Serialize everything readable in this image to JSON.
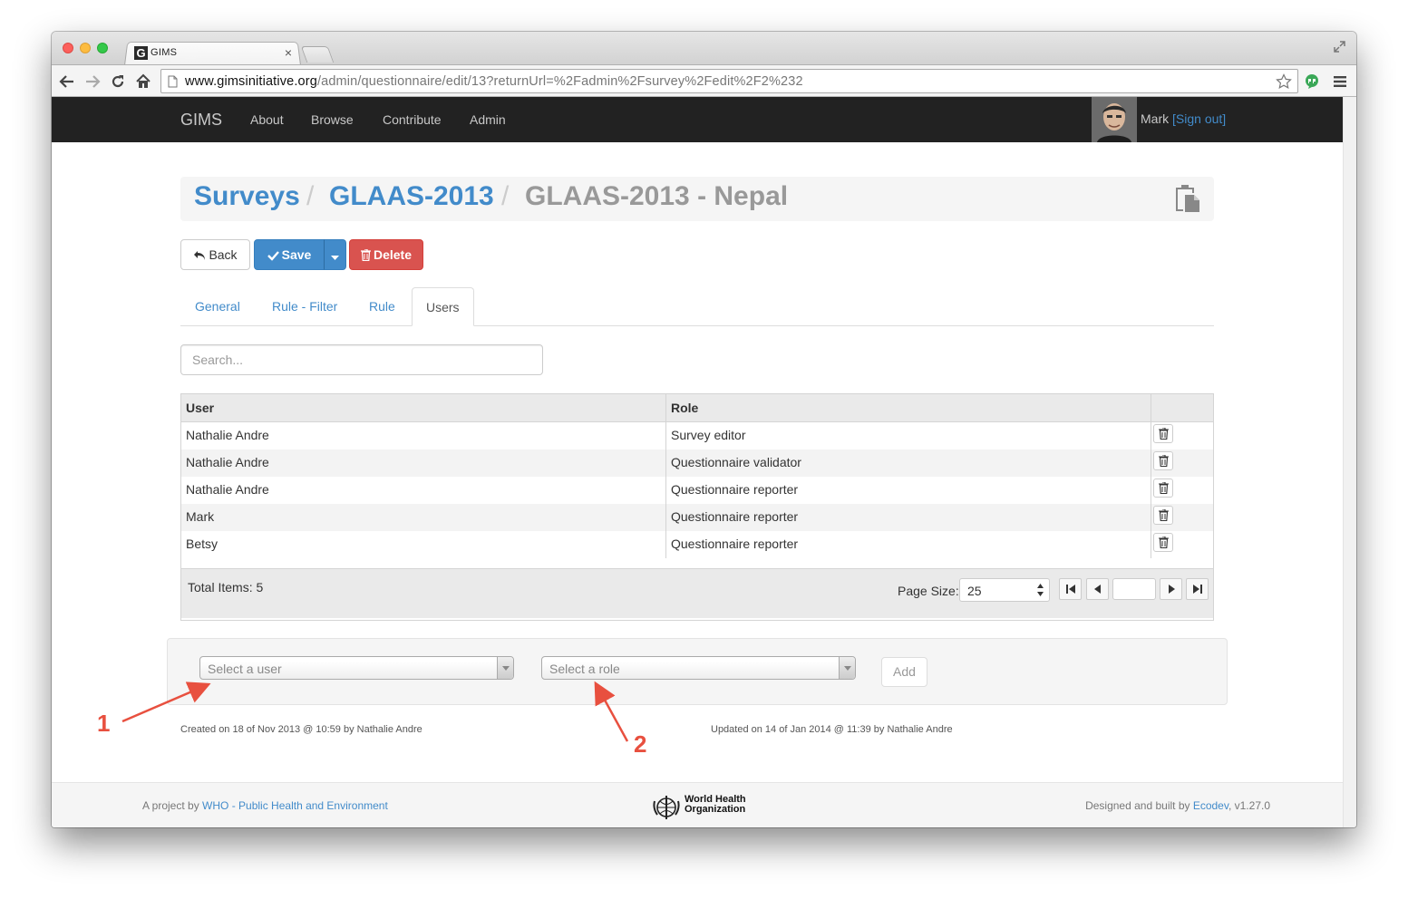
{
  "browser": {
    "tab_title": "GIMS",
    "tab_close": "×",
    "favicon_letter": "G",
    "url_host": "www.gimsinitiative.org",
    "url_path": "/admin/questionnaire/edit/13?returnUrl=%2Fadmin%2Fsurvey%2Fedit%2F2%232"
  },
  "navbar": {
    "brand": "GIMS",
    "links": [
      "About",
      "Browse",
      "Contribute",
      "Admin"
    ],
    "user_name": "Mark",
    "sign_out": "[Sign out]"
  },
  "breadcrumb": {
    "items": [
      "Surveys",
      "GLAAS-2013",
      "GLAAS-2013 - Nepal"
    ],
    "separator": "/"
  },
  "actions": {
    "back_label": "Back",
    "save_label": "Save",
    "delete_label": "Delete"
  },
  "tabs": [
    "General",
    "Rule - Filter",
    "Rule",
    "Users"
  ],
  "active_tab": "Users",
  "search": {
    "placeholder": "Search..."
  },
  "grid": {
    "columns": [
      "User",
      "Role"
    ],
    "rows": [
      {
        "user": "Nathalie Andre",
        "role": "Survey editor"
      },
      {
        "user": "Nathalie Andre",
        "role": "Questionnaire validator"
      },
      {
        "user": "Nathalie Andre",
        "role": "Questionnaire reporter"
      },
      {
        "user": "Mark",
        "role": "Questionnaire reporter"
      },
      {
        "user": "Betsy",
        "role": "Questionnaire reporter"
      }
    ],
    "total_items": "Total Items: 5",
    "page_size_label": "Page Size:",
    "page_size_value": "25"
  },
  "add_panel": {
    "user_placeholder": "Select a user",
    "role_placeholder": "Select a role",
    "add_label": "Add"
  },
  "meta": {
    "created": "Created on 18 of Nov 2013 @ 10:59 by Nathalie Andre",
    "updated": "Updated on 14 of Jan 2014 @ 11:39 by Nathalie Andre"
  },
  "footer": {
    "left_prefix": "A project by ",
    "left_link": "WHO - Public Health and Environment",
    "who_line1": "World Health",
    "who_line2": "Organization",
    "right_prefix": "Designed and built by ",
    "right_link": "Ecodev",
    "right_suffix": ", v1.27.0"
  },
  "annotations": [
    "1",
    "2"
  ],
  "colors": {
    "primary": "#428bca",
    "danger": "#d9534f",
    "navbar": "#222222",
    "annotation": "#e8503f"
  }
}
